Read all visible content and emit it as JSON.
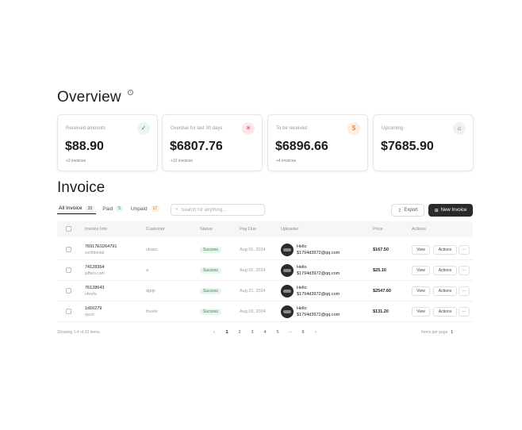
{
  "overview": {
    "title": "Overview",
    "cards": [
      {
        "label": "Received amounts",
        "value": "$88.90",
        "sub": "+3 invoices",
        "icon": "check-icon",
        "icon_glyph": "✓",
        "icon_bg": "#e8f6ee",
        "icon_color": "#2d8a4e"
      },
      {
        "label": "Overdue for last 30 days",
        "value": "$6807.76",
        "sub": "+12 invoices",
        "icon": "spinner-icon",
        "icon_glyph": "✳",
        "icon_bg": "#fde7ea",
        "icon_color": "#d9364f"
      },
      {
        "label": "To be received",
        "value": "$6896.66",
        "sub": "+4 invoices",
        "icon": "dollar-icon",
        "icon_glyph": "$",
        "icon_bg": "#fdeedd",
        "icon_color": "#d27a1a"
      },
      {
        "label": "Upcoming",
        "value": "$7685.90",
        "sub": "",
        "icon": "user-icon",
        "icon_glyph": "⌂",
        "icon_bg": "#f1f1f1",
        "icon_color": "#666"
      }
    ]
  },
  "invoice": {
    "title": "Invoice",
    "tabs": [
      {
        "label": "All Invoice",
        "count": "33"
      },
      {
        "label": "Paid",
        "count": "5"
      },
      {
        "label": "Unpaid",
        "count": "17"
      }
    ],
    "search_placeholder": "Search for anything...",
    "export_label": "Export",
    "new_label": "New Invoice",
    "columns": [
      "Invoice Info",
      "Customer",
      "Status",
      "Pay Due",
      "Uploader",
      "Price",
      "Actions"
    ],
    "rows": [
      {
        "id": "76917E0264791",
        "sub": "confidental",
        "customer": "ubasc",
        "status": "Success",
        "due": "Aug 01, 2024",
        "up_name": "Hello",
        "up_email": "$1794d3972@qq.com",
        "price": "$167.50"
      },
      {
        "id": "74128364",
        "sub": "jaffaro.com",
        "customer": "a",
        "status": "Success",
        "due": "Aug 01, 2024",
        "up_name": "Hello",
        "up_email": "$1794d3972@qq.com",
        "price": "$25.10"
      },
      {
        "id": "76128643",
        "sub": "ufwefa",
        "customer": "dgqk",
        "status": "Success",
        "due": "Aug 21, 2024",
        "up_name": "Hello",
        "up_email": "$1794d3972@qq.com",
        "price": "$2547.60"
      },
      {
        "id": "1d16279",
        "sub": "dycol",
        "customer": "thuvle",
        "status": "Success",
        "due": "Aug 03, 2024",
        "up_name": "Hello",
        "up_email": "$1794d3972@qq.com",
        "price": "$131.20"
      }
    ],
    "view_label": "View",
    "actions_label": "Actions",
    "more_label": "···",
    "footer_left": "Showing 1-4 of 33 items",
    "pages": [
      "‹",
      "1",
      "2",
      "3",
      "4",
      "5",
      "···",
      "8",
      "›"
    ],
    "rows_per_page_label": "Items per page",
    "rows_per_page_value": "1"
  }
}
